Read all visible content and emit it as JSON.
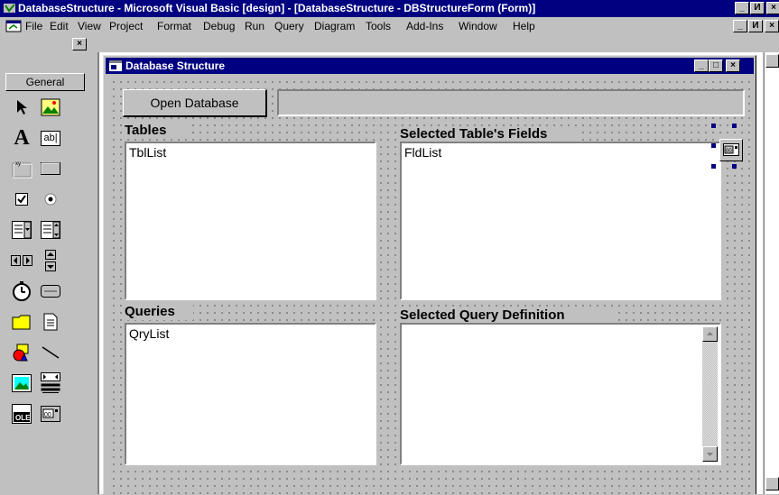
{
  "window": {
    "title": "DatabaseStructure - Microsoft Visual Basic [design] - [DatabaseStructure - DBStructureForm (Form)]",
    "caption_buttons": [
      "_",
      "И",
      "×"
    ]
  },
  "menubar": {
    "items": [
      {
        "label": "File"
      },
      {
        "label": "Edit"
      },
      {
        "label": "View"
      },
      {
        "label": "Project"
      },
      {
        "label": "Format"
      },
      {
        "label": "Debug"
      },
      {
        "label": "Run"
      },
      {
        "label": "Query"
      },
      {
        "label": "Diagram"
      },
      {
        "label": "Tools"
      },
      {
        "label": "Add-Ins"
      },
      {
        "label": "Window"
      },
      {
        "label": "Help"
      }
    ],
    "mdi_buttons": [
      "_",
      "И",
      "×"
    ]
  },
  "toolbox": {
    "close_label": "×",
    "tab_label": "General",
    "tools": [
      "pointer-icon",
      "picturebox-icon",
      "label-icon",
      "textbox-icon",
      "frame-icon",
      "commandbutton-icon",
      "checkbox-icon",
      "optionbutton-icon",
      "combobox-icon",
      "listbox-icon",
      "hscrollbar-icon",
      "vscrollbar-icon",
      "timer-icon",
      "drivelistbox-icon",
      "dirlistbox-icon",
      "filelistbox-icon",
      "shape-icon",
      "line-icon",
      "image-icon",
      "data-control-icon",
      "ole-icon",
      "data-extra-icon"
    ],
    "label_tool_glyph": "A",
    "textbox_tool_glyph": "ab|"
  },
  "form": {
    "title": "Database Structure",
    "open_button_label": "Open Database",
    "db_path_value": "",
    "tables_label": "Tables",
    "tables_list": [
      "TblList"
    ],
    "fields_label": "Selected Table's Fields",
    "fields_list": [
      "FldList"
    ],
    "queries_label": "Queries",
    "queries_list": [
      "QryList"
    ],
    "query_def_label": "Selected Query Definition",
    "query_def_value": ""
  },
  "colors": {
    "titlebar": "#000080",
    "face": "#c0c0c0",
    "selection_handle": "#000080"
  }
}
